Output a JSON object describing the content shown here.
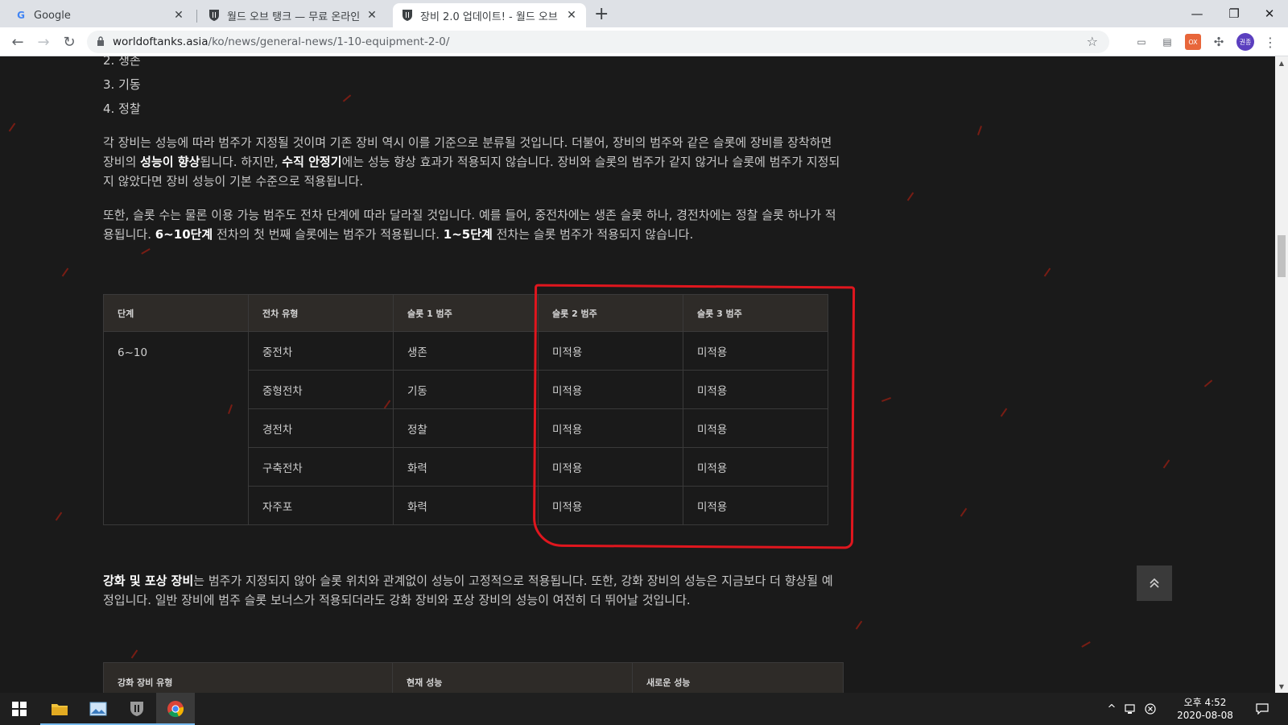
{
  "browser": {
    "tabs": [
      {
        "title": "Google",
        "favicon": "google-g-icon",
        "close": "✕"
      },
      {
        "title": "월드 오브 탱크 — 무료 온라인 ",
        "favicon": "wot-shield-icon",
        "close": "✕"
      },
      {
        "title": "장비 2.0 업데이트! - 월드 오브 ",
        "favicon": "wot-shield-icon",
        "close": "✕"
      }
    ],
    "new_tab": "+",
    "window_controls": {
      "minimize": "—",
      "restore": "❐",
      "close": "✕"
    },
    "nav": {
      "back": "←",
      "forward": "→",
      "reload": "↻"
    },
    "url_host": "worldoftanks.asia",
    "url_path": "/ko/news/general-news/1-10-equipment-2-0/",
    "profile_initials": "권종",
    "extension_badge": "OX"
  },
  "article": {
    "list_items": [
      "2. 생존",
      "3. 기동",
      "4. 정찰"
    ],
    "para1": {
      "t1": "각 장비는 성능에 따라 범주가 지정될 것이며 기존 장비 역시 이를 기준으로 분류될 것입니다. 더불어, 장비의 범주와 같은 슬롯에 장비를 장착하면 장비의 ",
      "b1": "성능이 향상",
      "t2": "됩니다. 하지만, ",
      "b2": "수직 안정기",
      "t3": "에는 성능 향상 효과가 적용되지 않습니다. 장비와 슬롯의 범주가 같지 않거나 슬롯에 범주가 지정되지 않았다면 장비 성능이 기본 수준으로 적용됩니다."
    },
    "para2": {
      "t1": "또한, 슬롯 수는 물론 이용 가능 범주도 전차 단계에 따라 달라질 것입니다. 예를 들어, 중전차에는 생존 슬롯 하나, 경전차에는 정찰 슬롯 하나가 적용됩니다. ",
      "b1": "6~10단계",
      "t2": " 전차의 첫 번째 슬롯에는 범주가 적용됩니다. ",
      "b2": "1~5단계",
      "t3": " 전차는 슬롯 범주가 적용되지 않습니다."
    },
    "table": {
      "headers": [
        "단계",
        "전차 유형",
        "슬롯 1 범주",
        "슬롯 2 범주",
        "슬롯 3 범주"
      ],
      "tier": "6~10",
      "rows": [
        [
          "중전차",
          "생존",
          "미적용",
          "미적용"
        ],
        [
          "중형전차",
          "기동",
          "미적용",
          "미적용"
        ],
        [
          "경전차",
          "정찰",
          "미적용",
          "미적용"
        ],
        [
          "구축전차",
          "화력",
          "미적용",
          "미적용"
        ],
        [
          "자주포",
          "화력",
          "미적용",
          "미적용"
        ]
      ]
    },
    "para3": {
      "b1": "강화 및 포상 장비",
      "t1": "는 범주가 지정되지 않아 슬롯 위치와 관계없이 성능이 고정적으로 적용됩니다. 또한, 강화 장비의 성능은 지금보다 더 향상될 예정입니다. 일반 장비에 범주 슬롯 보너스가 적용되더라도 강화 장비와 포상 장비의 성능이 여전히 더 뛰어날 것입니다."
    },
    "table2_headers": [
      "강화 장비 유형",
      "현재 성능",
      "새로운 성능"
    ],
    "scroll_top": "⌃",
    "highlight_color": "#e0161e"
  },
  "taskbar": {
    "clock_time": "오후 4:52",
    "clock_date": "2020-08-08",
    "tray_up": "^"
  }
}
